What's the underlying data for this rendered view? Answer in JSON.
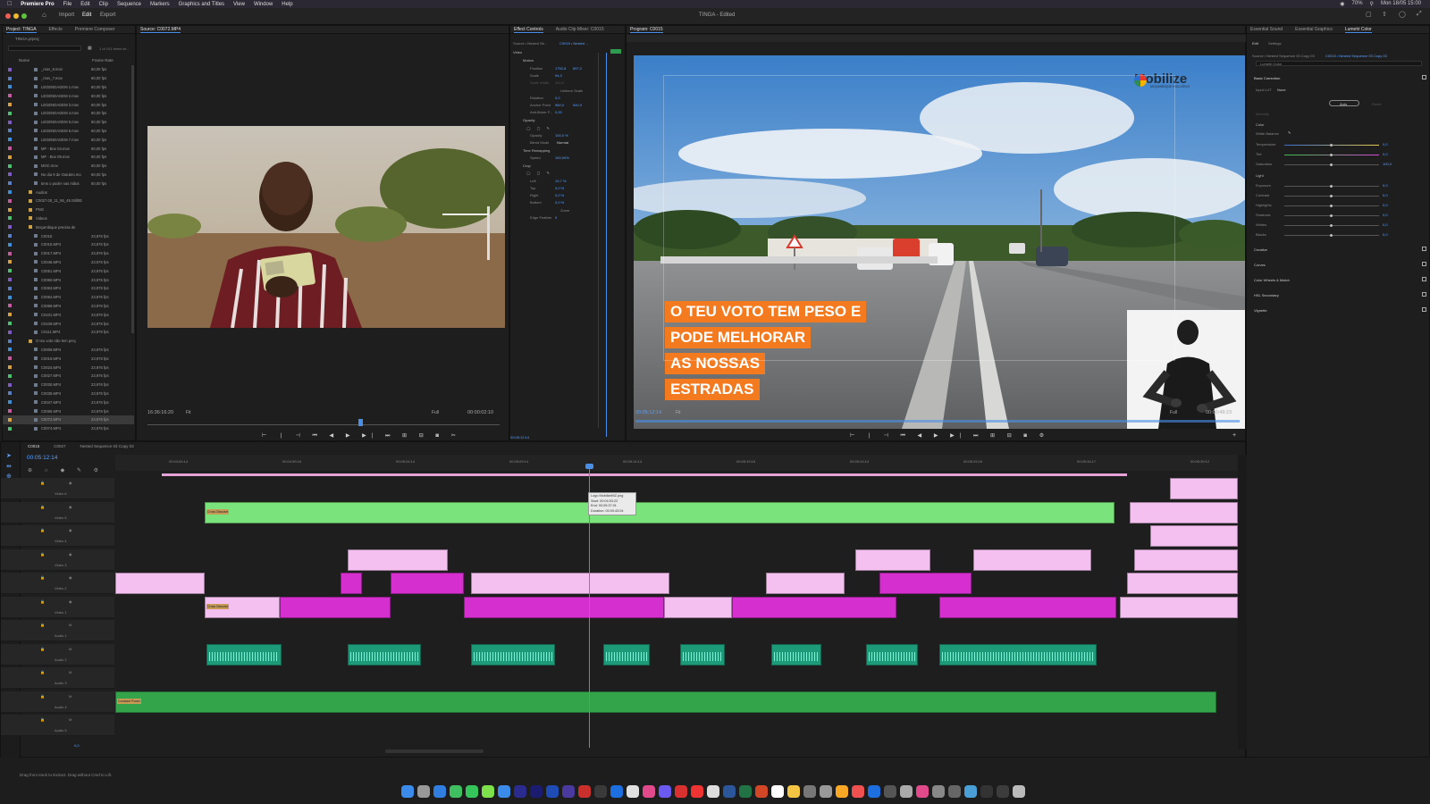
{
  "menubar": {
    "app": "Premiere Pro",
    "items": [
      "File",
      "Edit",
      "Clip",
      "Sequence",
      "Markers",
      "Graphics and Titles",
      "View",
      "Window",
      "Help"
    ],
    "clock": "Mon 18/05  15:00",
    "battery": "70%"
  },
  "header": {
    "workspaces": [
      "Import",
      "Edit",
      "Export"
    ],
    "title": "TINGA - Edited"
  },
  "project": {
    "tabs": [
      "Project: TINGA",
      "Effects",
      "Premiere Composer"
    ],
    "name": "TINGA.prproj",
    "count": "1 of 101 items se...",
    "col_name": "Name",
    "col_rate": "Frame Rate",
    "items": [
      {
        "name": "_mov_6.mov",
        "rate": "60,00 fps"
      },
      {
        "name": "_mov_7.mov",
        "rate": "60,00 fps"
      },
      {
        "name": "LEGENDAGEM 1.mov",
        "rate": "60,00 fps"
      },
      {
        "name": "LEGENDAGEM 2.mov",
        "rate": "60,00 fps"
      },
      {
        "name": "LEGENDAGEM 3.mov",
        "rate": "60,00 fps"
      },
      {
        "name": "LEGENDAGEM 4.mov",
        "rate": "60,00 fps"
      },
      {
        "name": "LEGENDAGEM 5.mov",
        "rate": "60,00 fps"
      },
      {
        "name": "LEGENDAGEM 6.mov",
        "rate": "60,00 fps"
      },
      {
        "name": "LEGENDAGEM 7.mov",
        "rate": "60,00 fps"
      },
      {
        "name": "MF - Box 04.mov",
        "rate": "60,00 fps"
      },
      {
        "name": "MF - Box 09.mov",
        "rate": "60,00 fps"
      },
      {
        "name": "MOC.mov",
        "rate": "60,00 fps"
      },
      {
        "name": "No dia 9 de Outubro.mo",
        "rate": "60,00 fps"
      },
      {
        "name": "tens o poder nas mãos",
        "rate": "60,00 fps"
      },
      {
        "name": "Audios",
        "rate": ""
      },
      {
        "name": "C0027.00_11_56_49.Still002",
        "rate": ""
      },
      {
        "name": "PNG",
        "rate": ""
      },
      {
        "name": "Videos",
        "rate": ""
      },
      {
        "name": "Moçambique precisa de",
        "rate": ""
      },
      {
        "name": "C0015",
        "rate": "23,976 fps"
      },
      {
        "name": "C0015.MP4",
        "rate": "23,976 fps"
      },
      {
        "name": "C0017.MP4",
        "rate": "23,976 fps"
      },
      {
        "name": "C0048.MP4",
        "rate": "23,976 fps"
      },
      {
        "name": "C0051.MP4",
        "rate": "23,976 fps"
      },
      {
        "name": "C0060.MP4",
        "rate": "23,976 fps"
      },
      {
        "name": "C0063.MP4",
        "rate": "23,976 fps"
      },
      {
        "name": "C0064.MP4",
        "rate": "23,976 fps"
      },
      {
        "name": "C0068.MP4",
        "rate": "23,976 fps"
      },
      {
        "name": "C0101.MP4",
        "rate": "23,976 fps"
      },
      {
        "name": "C0109.MP4",
        "rate": "23,976 fps"
      },
      {
        "name": "C0111.MP4",
        "rate": "23,976 fps"
      },
      {
        "name": "O teu voto não tem preç",
        "rate": ""
      },
      {
        "name": "C0009.MP4",
        "rate": "23,976 fps"
      },
      {
        "name": "C0019.MP4",
        "rate": "23,976 fps"
      },
      {
        "name": "C0024.MP4",
        "rate": "23,976 fps"
      },
      {
        "name": "C0027.MP4",
        "rate": "23,976 fps"
      },
      {
        "name": "C0030.MP4",
        "rate": "23,976 fps"
      },
      {
        "name": "C0035.MP4",
        "rate": "23,976 fps"
      },
      {
        "name": "C0047.MP4",
        "rate": "23,976 fps"
      },
      {
        "name": "C0065.MP4",
        "rate": "23,976 fps"
      },
      {
        "name": "C0072.MP4",
        "rate": "23,976 fps"
      },
      {
        "name": "C0074.MP4",
        "rate": "23,976 fps"
      }
    ]
  },
  "source": {
    "tab": "Source: C0072.MP4",
    "timecode": "16:36:16:20",
    "fit": "Fit",
    "full": "Full",
    "duration": "00:00:02:10"
  },
  "effects": {
    "tabs": [
      "Effect Controls",
      "Audio Clip Mixer: C0015"
    ],
    "source": "Source • Nested Se...",
    "target": "C0015 • Nested ...",
    "video": "Video",
    "motion": "Motion",
    "position": "Position",
    "pos_x": "1752,8",
    "pos_y": "897,2",
    "scale": "Scale",
    "scale_v": "94,3",
    "scale_w": "Scale Width",
    "scale_w_v": "100,0",
    "uniform": "Uniform Scale",
    "rotation": "Rotation",
    "rotation_v": "0,0",
    "anchor": "Anchor Point",
    "anc_x": "960,0",
    "anc_y": "540,0",
    "antiflicker": "Anti-flicker F...",
    "antiflicker_v": "0,00",
    "opacity": "Opacity",
    "opacity_v": "100,0 %",
    "blend": "Blend Mode",
    "blend_v": "Normal",
    "remap": "Time Remapping",
    "speed": "Speed",
    "speed_v": "100,00%",
    "crop": "Crop",
    "left": "Left",
    "left_v": "19,7 %",
    "top": "Top",
    "top_v": "0,0 %",
    "right": "Right",
    "right_v": "0,0 %",
    "bottom": "Bottom",
    "bottom_v": "0,0 %",
    "zoom": "Zoom",
    "edge": "Edge Feather",
    "edge_v": "0",
    "tc": "00:05:12:14"
  },
  "program": {
    "tab": "Program: C0015",
    "timecode": "00:05:12:14",
    "fit": "Fit",
    "full": "Full",
    "duration": "00:00:49:23",
    "logo": "Mobilize",
    "logo_sub": "MOÇAMBIQUE INCLUSIVO",
    "caption": [
      "O TEU VOTO TEM PESO E",
      "PODE MELHORAR",
      "AS NOSSAS",
      "ESTRADAS"
    ]
  },
  "lumetri": {
    "tabs": [
      "Essential Sound",
      "Essential Graphics",
      "Lumetri Color"
    ],
    "sub": [
      "Edit",
      "Settings"
    ],
    "source": "Source • Nested Sequence 03 Copy 03",
    "target": "C0015 • Nested Sequence 03 Copy 03",
    "fx": "Lumetri Color",
    "basic": "Basic Correction",
    "input_lut": "Input LUT",
    "lut_v": "None",
    "auto": "Auto",
    "reset": "Reset",
    "intensity": "Intensity",
    "color": "Color",
    "wb": "White Balance",
    "temp": "Temperature",
    "temp_v": "0,0",
    "tint": "Tint",
    "tint_v": "0,0",
    "sat": "Saturation",
    "sat_v": "100,0",
    "light": "Light",
    "exposure": "Exposure",
    "exposure_v": "0,0",
    "contrast": "Contrast",
    "contrast_v": "0,0",
    "highlights": "Highlights",
    "highlights_v": "0,0",
    "shadows": "Shadows",
    "shadows_v": "0,0",
    "whites": "Whites",
    "whites_v": "0,0",
    "blacks": "Blacks",
    "blacks_v": "0,0",
    "sections": [
      "Creative",
      "Curves",
      "Color Wheels & Match",
      "HSL Secondary",
      "Vignette"
    ]
  },
  "timeline": {
    "tabs": [
      "C0015",
      "C0027",
      "Nested Sequence 03 Copy 03"
    ],
    "timecode": "00:05:12:14",
    "ruler": [
      "00:04:54:14",
      "00:04:59:16",
      "00:05:04:14",
      "00:05:09:14",
      "00:05:14:14",
      "00:05:19:16",
      "00:05:24:14",
      "00:05:29:16",
      "00:05:34:17",
      "00:05:39:12"
    ],
    "tooltip": [
      "Logo MobilizeMZ.png",
      "Start: 00:04:53:22",
      "End: 00:05:37:01",
      "Duration: 00:00:43:04"
    ],
    "tracks": [
      "Video 6",
      "Video 5",
      "Video 4",
      "Video 3",
      "Video 2",
      "Video 1",
      "Audio 1",
      "Audio 2",
      "Audio 3",
      "Audio 4",
      "Audio 5"
    ],
    "clip_labels": {
      "cross": "Cross Dissolve",
      "const": "Constant Power"
    },
    "master": "0,0"
  },
  "status": {
    "hint": "Drag from track to Extract. Drag without Cmd to Lift."
  },
  "colors": {
    "green": "#7be37b",
    "pink": "#f3c0f0",
    "magenta": "#d52fd0",
    "audio": "#1d9b78",
    "audio_dark": "#34a44a",
    "accent": "#4a8fe7",
    "orange": "#f47a20"
  }
}
